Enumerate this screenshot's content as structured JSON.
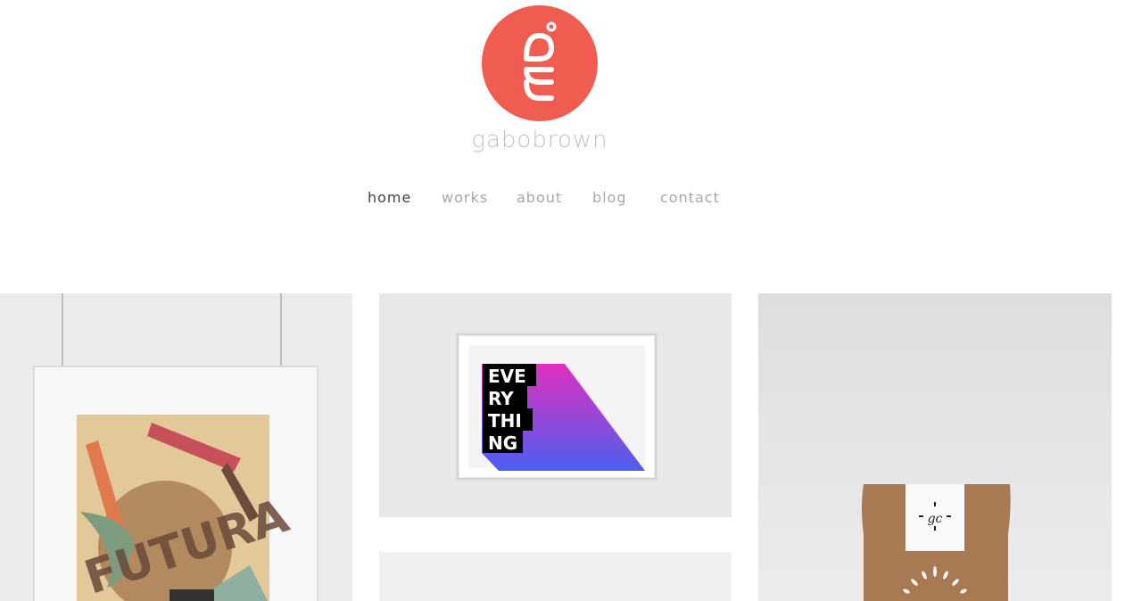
{
  "brand": {
    "name": "gabobrown",
    "accent_color": "#f15c50",
    "logo_icon": "gm-monogram-circle"
  },
  "nav": {
    "items": [
      {
        "label": "home",
        "active": true
      },
      {
        "label": "works",
        "active": false
      },
      {
        "label": "about",
        "active": false
      },
      {
        "label": "blog",
        "active": false
      },
      {
        "label": "contact",
        "active": false
      }
    ]
  },
  "portfolio": {
    "tiles": [
      {
        "name": "futura-poster",
        "poster_text": "FUTURA"
      },
      {
        "name": "everything-print",
        "poster_lines": [
          "EVE",
          "RY",
          "THI",
          "NG"
        ]
      },
      {
        "name": "coffee-pouch",
        "label_text": "gc"
      },
      {
        "name": "blank-tile"
      }
    ]
  }
}
